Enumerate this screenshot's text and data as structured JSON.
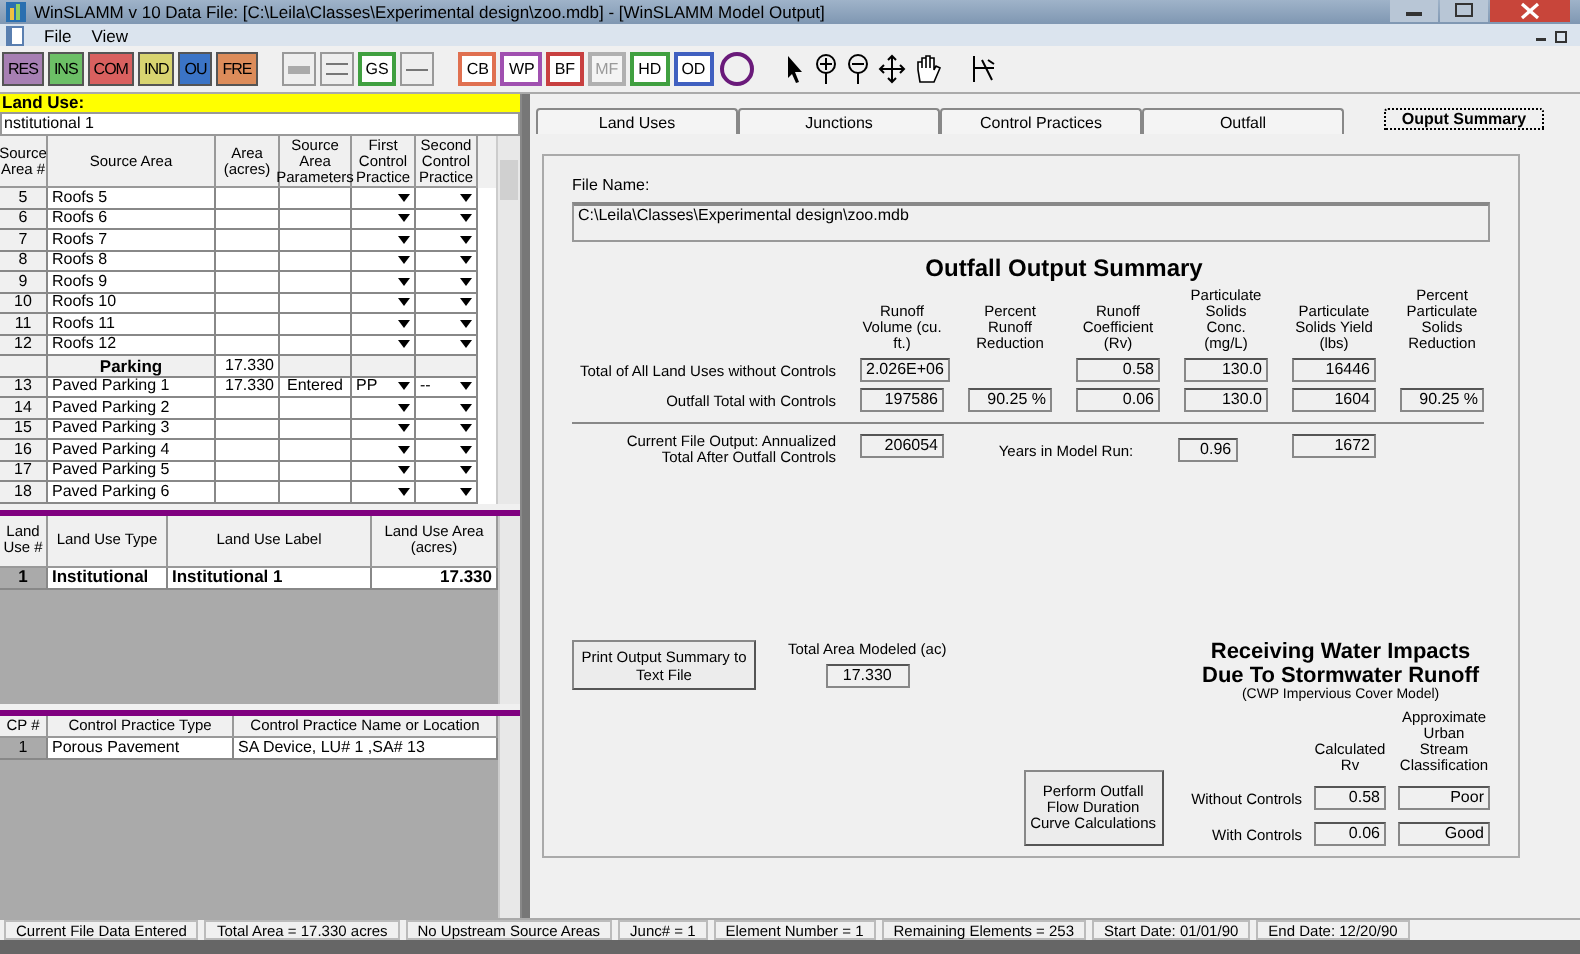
{
  "window": {
    "title": "WinSLAMM v 10 Data File:   [C:\\Leila\\Classes\\Experimental design\\zoo.mdb] - [WinSLAMM Model Output]"
  },
  "menu": [
    "File",
    "View"
  ],
  "land_use_buttons": [
    {
      "label": "RES",
      "color": "#a77fb3"
    },
    {
      "label": "INS",
      "color": "#6cbf66"
    },
    {
      "label": "COM",
      "color": "#d9605f"
    },
    {
      "label": "IND",
      "color": "#d8d470"
    },
    {
      "label": "OU",
      "color": "#3b74c6"
    },
    {
      "label": "FRE",
      "color": "#dc8c5a"
    }
  ],
  "element_buttons": [
    {
      "label": "CB",
      "color": "#e07050",
      "disabled": false
    },
    {
      "label": "WP",
      "color": "#a050b0",
      "disabled": false
    },
    {
      "label": "BF",
      "color": "#c84040",
      "disabled": false
    },
    {
      "label": "MF",
      "color": "#b0b0b0",
      "disabled": true
    },
    {
      "label": "HD",
      "color": "#40a040",
      "disabled": false
    },
    {
      "label": "OD",
      "color": "#4060c0",
      "disabled": false
    }
  ],
  "gs_button": {
    "label": "GS",
    "color": "#40a040"
  },
  "left": {
    "land_use_label": "Land Use:",
    "land_use_value": "nstitutional 1",
    "source_table": {
      "columns": [
        "Source Area #",
        "Source Area",
        "Area (acres)",
        "Source Area Parameters",
        "First Control Practice",
        "Second Control Practice"
      ],
      "rows": [
        {
          "kind": "row",
          "num": "5",
          "name": "Roofs 5"
        },
        {
          "kind": "row",
          "num": "6",
          "name": "Roofs 6"
        },
        {
          "kind": "row",
          "num": "7",
          "name": "Roofs 7"
        },
        {
          "kind": "row",
          "num": "8",
          "name": "Roofs 8"
        },
        {
          "kind": "row",
          "num": "9",
          "name": "Roofs 9"
        },
        {
          "kind": "row",
          "num": "10",
          "name": "Roofs 10"
        },
        {
          "kind": "row",
          "num": "11",
          "name": "Roofs 11"
        },
        {
          "kind": "row",
          "num": "12",
          "name": "Roofs 12"
        },
        {
          "kind": "group",
          "name": "Parking",
          "area": "17.330"
        },
        {
          "kind": "row",
          "num": "13",
          "name": "Paved Parking 1",
          "area": "17.330",
          "params": "Entered",
          "first": "PP",
          "second": "--"
        },
        {
          "kind": "row",
          "num": "14",
          "name": "Paved Parking 2"
        },
        {
          "kind": "row",
          "num": "15",
          "name": "Paved Parking 3"
        },
        {
          "kind": "row",
          "num": "16",
          "name": "Paved Parking 4"
        },
        {
          "kind": "row",
          "num": "17",
          "name": "Paved Parking 5"
        },
        {
          "kind": "row",
          "num": "18",
          "name": "Paved Parking 6"
        }
      ]
    },
    "land_use_table": {
      "columns": [
        "Land Use #",
        "Land Use Type",
        "Land Use Label",
        "Land Use Area (acres)"
      ],
      "rows": [
        {
          "num": "1",
          "type": "Institutional",
          "label": "Institutional 1",
          "area": "17.330"
        }
      ]
    },
    "control_table": {
      "columns": [
        "CP #",
        "Control Practice Type",
        "Control Practice Name or Location"
      ],
      "rows": [
        {
          "num": "1",
          "type": "Porous Pavement",
          "name": "SA Device, LU# 1 ,SA# 13"
        }
      ]
    }
  },
  "tabs": [
    {
      "label": "Land Uses",
      "selected": false
    },
    {
      "label": "Junctions",
      "selected": false
    },
    {
      "label": "Control Practices",
      "selected": false
    },
    {
      "label": "Outfall",
      "selected": false
    },
    {
      "label": "Ouput Summary",
      "selected": true
    }
  ],
  "summary": {
    "file_name_label": "File Name:",
    "file_name": "C:\\Leila\\Classes\\Experimental design\\zoo.mdb",
    "title": "Outfall Output Summary",
    "columns": [
      "Runoff Volume (cu. ft.)",
      "Percent Runoff Reduction",
      "Runoff Coefficient (Rv)",
      "Particulate Solids Conc. (mg/L)",
      "Particulate Solids Yield (lbs)",
      "Percent Particulate Solids Reduction"
    ],
    "rows": [
      {
        "label": "Total of All Land Uses without Controls",
        "volume": "2.026E+06",
        "rv": "0.58",
        "conc": "130.0",
        "yield": "16446"
      },
      {
        "label": "Outfall Total with Controls",
        "volume": "197586",
        "reduction": "90.25 %",
        "rv": "0.06",
        "conc": "130.0",
        "yield": "1604",
        "solids_reduction": "90.25 %"
      }
    ],
    "annualized_label": "Current File Output:  Annualized\nTotal After Outfall Controls",
    "annualized_volume": "206054",
    "years_label": "Years in Model Run:",
    "years": "0.96",
    "annualized_yield": "1672",
    "print_button": "Print Output Summary to Text File",
    "total_area_label": "Total Area Modeled (ac)",
    "total_area": "17.330",
    "flow_button": "Perform Outfall Flow Duration Curve Calculations"
  },
  "receiving": {
    "title": "Receiving Water Impacts Due To Stormwater Runoff",
    "subtitle": "(CWP Impervious Cover Model)",
    "columns": [
      "Calculated Rv",
      "Approximate Urban Stream Classification"
    ],
    "rows": [
      {
        "label": "Without Controls",
        "rv": "0.58",
        "classification": "Poor"
      },
      {
        "label": "With Controls",
        "rv": "0.06",
        "classification": "Good"
      }
    ]
  },
  "status_bar": [
    "Current File Data Entered",
    "Total Area = 17.330 acres",
    "No Upstream Source Areas",
    "Junc# = 1",
    "Element Number = 1",
    "Remaining Elements =  253",
    "Start Date:  01/01/90",
    "End Date:  12/20/90"
  ]
}
